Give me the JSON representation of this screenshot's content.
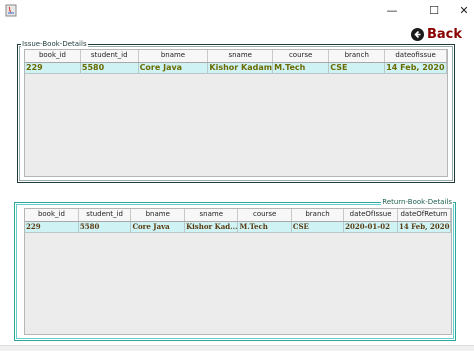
{
  "window": {
    "minimize_glyph": "—",
    "maximize_glyph": "☐",
    "close_glyph": "✕"
  },
  "back_button": {
    "label": "Back",
    "icon": "back-arrow-icon"
  },
  "issue_section": {
    "title": "Issue-Book-Details",
    "columns": [
      "book_id",
      "student_id",
      "bname",
      "sname",
      "course",
      "branch",
      "dateofissue"
    ],
    "rows": [
      [
        "229",
        "5580",
        "Core Java",
        "Kishor Kadam",
        "M.Tech",
        "CSE",
        "14 Feb, 2020"
      ]
    ]
  },
  "return_section": {
    "title": "Return-Book-Details",
    "columns": [
      "book_id",
      "student_id",
      "bname",
      "sname",
      "course",
      "branch",
      "dateOfIssue",
      "dateOfReturn"
    ],
    "rows": [
      [
        "229",
        "5580",
        "Core Java",
        "Kishor Kad...",
        "M.Tech",
        "CSE",
        "2020-01-02",
        "14 Feb, 2020"
      ]
    ]
  },
  "colors": {
    "back_label": "#8b0000",
    "issue_cell_text": "#6b6b00",
    "return_cell_text": "#5a3a10",
    "row_highlight": "#cff2f4",
    "issue_border": "#1f3b3b",
    "return_border": "#2aa89a"
  }
}
